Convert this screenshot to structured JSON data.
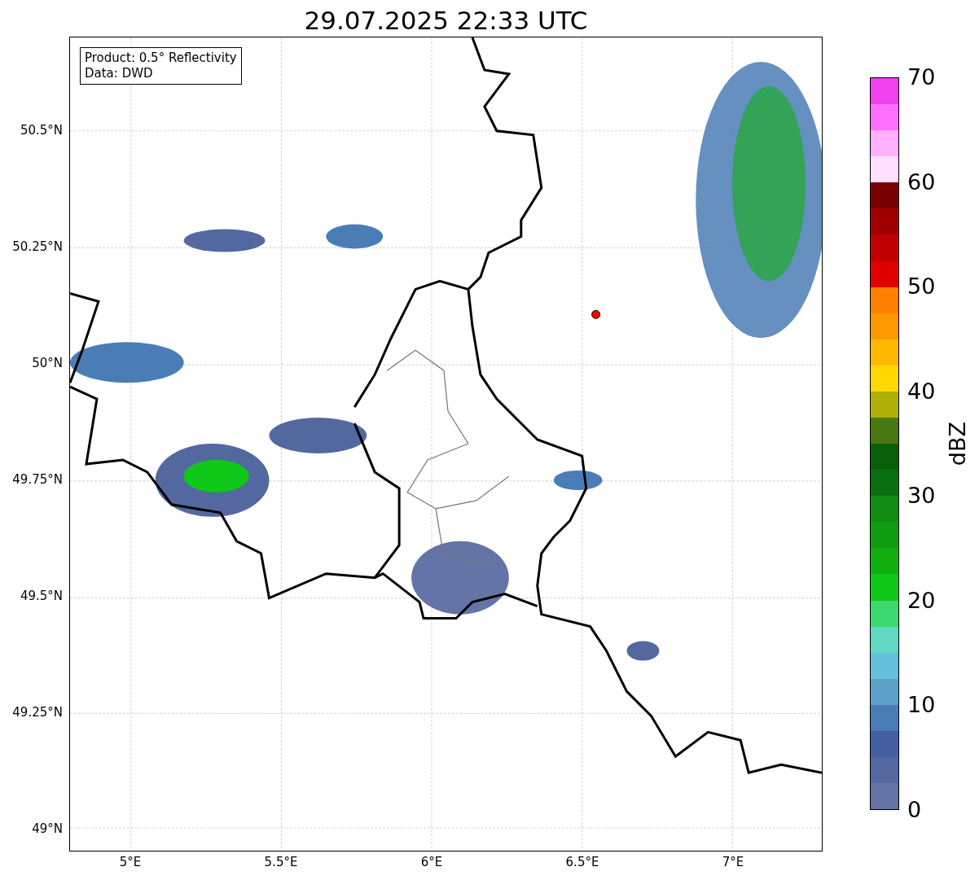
{
  "title": "29.07.2025 22:33 UTC",
  "info_box": [
    "Product: 0.5° Reflectivity",
    "Data: DWD"
  ],
  "y_ticks": [
    "50.5°N",
    "50.25°N",
    "50°N",
    "49.75°N",
    "49.5°N",
    "49.25°N",
    "49°N"
  ],
  "x_ticks": [
    "5°E",
    "5.5°E",
    "6°E",
    "6.5°E",
    "7°E"
  ],
  "colorbar": {
    "ticks": [
      "70",
      "60",
      "50",
      "40",
      "30",
      "20",
      "10",
      "0"
    ],
    "label": "dBZ",
    "segments": [
      {
        "color": "#f040f0"
      },
      {
        "color": "#ff70ff"
      },
      {
        "color": "#ffb0ff"
      },
      {
        "color": "#ffe0ff"
      },
      {
        "color": "#780000"
      },
      {
        "color": "#a00000"
      },
      {
        "color": "#c00000"
      },
      {
        "color": "#e00000"
      },
      {
        "color": "#ff8000"
      },
      {
        "color": "#ff9800"
      },
      {
        "color": "#ffb800"
      },
      {
        "color": "#ffd800"
      },
      {
        "color": "#b0b008"
      },
      {
        "color": "#487810"
      },
      {
        "color": "#086008"
      },
      {
        "color": "#087010"
      },
      {
        "color": "#108c10"
      },
      {
        "color": "#109c10"
      },
      {
        "color": "#10b010"
      },
      {
        "color": "#10c818"
      },
      {
        "color": "#3cd870"
      },
      {
        "color": "#60d8c4"
      },
      {
        "color": "#64c0dc"
      },
      {
        "color": "#5aa0c8"
      },
      {
        "color": "#4a7db5"
      },
      {
        "color": "#4460a3"
      },
      {
        "color": "#5468a0"
      },
      {
        "color": "#6474a6"
      }
    ]
  }
}
